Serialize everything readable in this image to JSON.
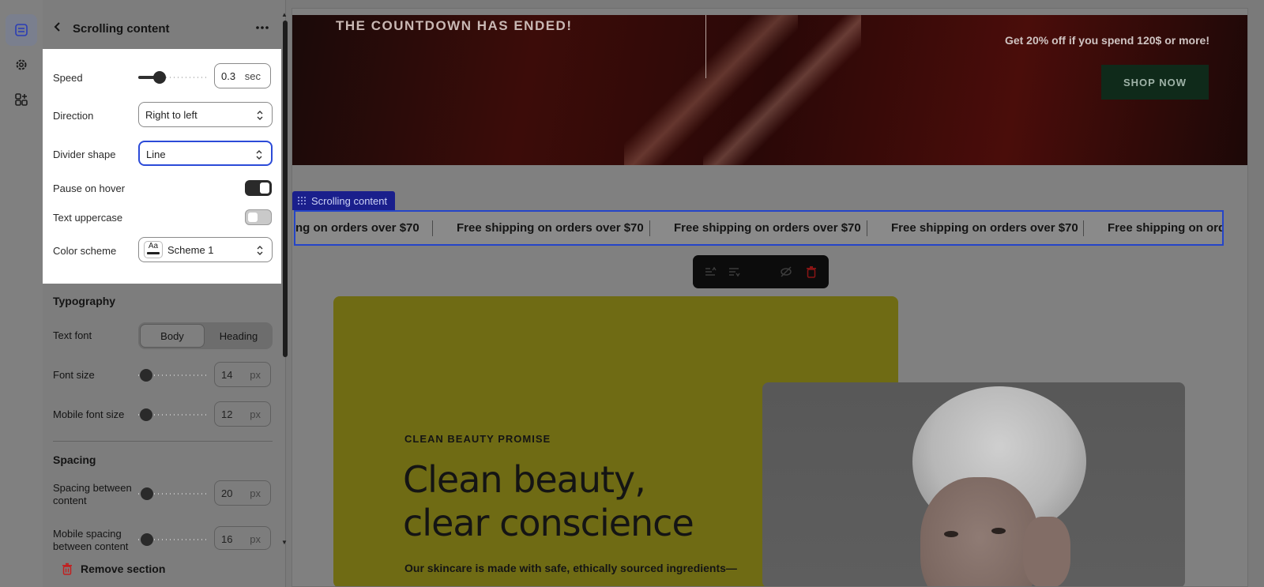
{
  "panel": {
    "title": "Scrolling content",
    "rows": {
      "speed": {
        "label": "Speed",
        "value": "0.3",
        "unit": "sec",
        "fraction": 0.27
      },
      "direction": {
        "label": "Direction",
        "value": "Right to left"
      },
      "divider_shape": {
        "label": "Divider shape",
        "value": "Line"
      },
      "pause_on_hover": {
        "label": "Pause on hover",
        "on": true
      },
      "text_uppercase": {
        "label": "Text uppercase",
        "on": false
      },
      "color_scheme": {
        "label": "Color scheme",
        "swatch": "Aa",
        "value": "Scheme 1"
      }
    },
    "typography": {
      "title": "Typography",
      "text_font": {
        "label": "Text font",
        "options": [
          "Body",
          "Heading"
        ],
        "selected": "Body"
      },
      "font_size": {
        "label": "Font size",
        "value": "14",
        "unit": "px"
      },
      "mobile_font_size": {
        "label": "Mobile font size",
        "value": "12",
        "unit": "px"
      }
    },
    "spacing": {
      "title": "Spacing",
      "between": {
        "label": "Spacing between content",
        "value": "20",
        "unit": "px"
      },
      "mobile_between": {
        "label": "Mobile spacing between content",
        "value": "16",
        "unit": "px"
      }
    },
    "remove_label": "Remove section"
  },
  "preview": {
    "countdown": "THE COUNTDOWN HAS ENDED!",
    "offer": "Get 20% off if you spend 120$ or more!",
    "shop_button": "SHOP NOW",
    "section_tag": "Scrolling content",
    "marquee_first": "ng on orders over $70",
    "marquee_item": "Free shipping on orders over $70",
    "marquee_last": "Free shipping on orders",
    "promo_eyebrow": "CLEAN BEAUTY PROMISE",
    "promo_title": "Clean beauty, clear conscience",
    "promo_body": "Our skincare is made with safe, ethically sourced ingredients—"
  },
  "colors": {
    "accent": "#2c4bd8",
    "promo_bg": "#6f6b14",
    "hero_bg": "#3c0c09",
    "shop_btn": "#0f2a1a",
    "delete": "#d92c2c"
  },
  "icons": [
    "sections-icon",
    "settings-gear-icon",
    "apps-icon",
    "chevron-left-icon",
    "more-dots-icon",
    "trash-icon",
    "grid-drag-icon",
    "move-up-icon",
    "move-down-icon",
    "hide-eye-icon",
    "delete-icon"
  ]
}
